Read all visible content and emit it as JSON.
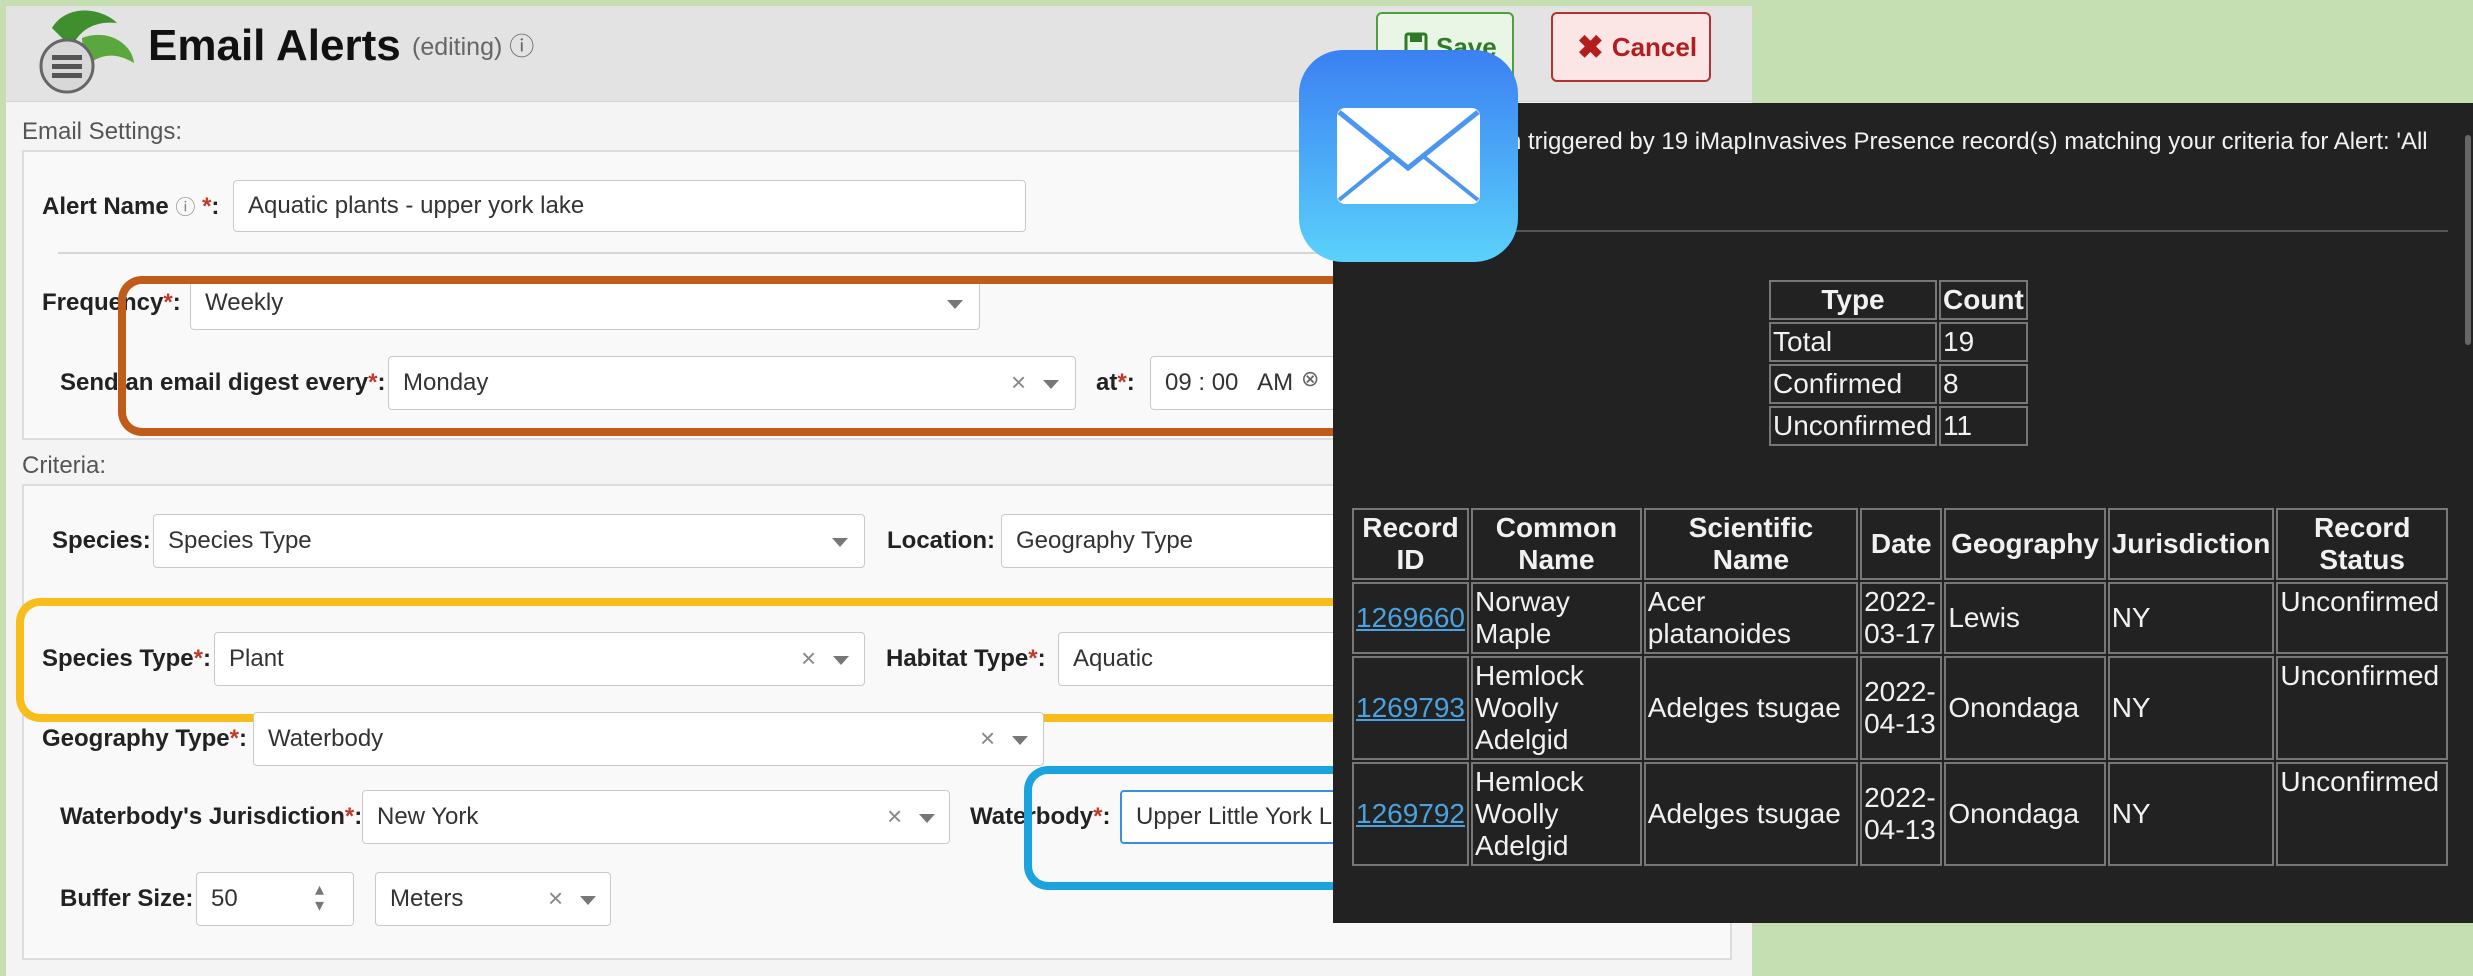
{
  "header": {
    "title": "Email Alerts",
    "mode": "(editing)",
    "info_glyph": "ⓘ",
    "save_label": "Save",
    "cancel_label": "Cancel"
  },
  "email_settings": {
    "section_label": "Email Settings:",
    "alert_name_label": "Alert Name",
    "alert_name_value": "Aquatic plants - upper york lake",
    "frequency_label": "Frequency",
    "frequency_value": "Weekly",
    "digest_label": "Send an email digest every",
    "digest_value": "Monday",
    "at_label": "at",
    "time_value": "09 : 00   AM"
  },
  "criteria": {
    "section_label": "Criteria:",
    "species_label": "Species:",
    "species_value": "Species Type",
    "location_label": "Location:",
    "location_value": "Geography Type",
    "species_type_label": "Species Type",
    "species_type_value": "Plant",
    "habitat_type_label": "Habitat Type",
    "habitat_type_value": "Aquatic",
    "geography_type_label": "Geography Type",
    "geography_type_value": "Waterbody",
    "jurisdiction_label": "Waterbody's Jurisdiction",
    "jurisdiction_value": "New York",
    "waterbody_label": "Waterbody",
    "waterbody_value": "Upper Little York L",
    "buffer_label": "Buffer Size:",
    "buffer_value": "50",
    "buffer_unit": "Meters"
  },
  "email_preview": {
    "intro": "n triggered by 19 iMapInvasives Presence record(s) matching your criteria for Alert: 'All",
    "summary_headers": [
      "Type",
      "Count"
    ],
    "summary_rows": [
      [
        "Total",
        "19"
      ],
      [
        "Confirmed",
        "8"
      ],
      [
        "Unconfirmed",
        "11"
      ]
    ],
    "record_headers": [
      "Record ID",
      "Common Name",
      "Scientific Name",
      "Date",
      "Geography",
      "Jurisdiction",
      "Record Status"
    ],
    "records": [
      [
        "1269660",
        "Norway Maple",
        "Acer platanoides",
        "2022-03-17",
        "Lewis",
        "NY",
        "Unconfirmed"
      ],
      [
        "1269793",
        "Hemlock Woolly Adelgid",
        "Adelges tsugae",
        "2022-04-13",
        "Onondaga",
        "NY",
        "Unconfirmed"
      ],
      [
        "1269792",
        "Hemlock Woolly Adelgid",
        "Adelges tsugae",
        "2022-04-13",
        "Onondaga",
        "NY",
        "Unconfirmed"
      ]
    ]
  },
  "colors": {
    "frequency_highlight": "#c05b1b",
    "species_highlight": "#f8bd1a",
    "waterbody_highlight": "#1aa3dd",
    "link": "#4aa3e0"
  },
  "icons": [
    "logo-icon",
    "info-icon",
    "save-icon",
    "cancel-icon",
    "clear-icon",
    "chevron-down-icon",
    "stepper-icon",
    "mail-app-icon"
  ]
}
